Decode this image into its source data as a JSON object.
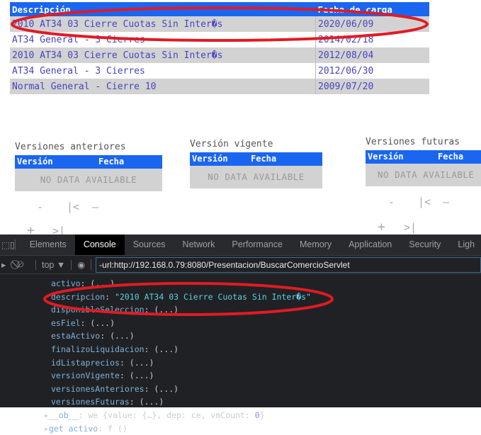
{
  "main_table": {
    "headers": [
      "Descripción",
      "Fecha de carga"
    ],
    "rows": [
      {
        "descripcion": "2010 AT34 03 Cierre Cuotas Sin Inter�s",
        "fecha": "2020/06/09"
      },
      {
        "descripcion": "AT34 General - 3 Cierres",
        "fecha": "2014/02/18"
      },
      {
        "descripcion": "2010 AT34 03 Cierre Cuotas Sin Inter�s",
        "fecha": "2012/08/04"
      },
      {
        "descripcion": "AT34 General - 3 Cierres",
        "fecha": "2012/06/30"
      },
      {
        "descripcion": "Normal General - Cierre 10",
        "fecha": "2009/07/20"
      }
    ]
  },
  "versions": {
    "anteriores": {
      "title": "Versiones anteriores",
      "col1": "Versión",
      "col2": "Fecha",
      "empty": "NO DATA AVAILABLE"
    },
    "vigente": {
      "title": "Versión vigente",
      "col1": "Versión",
      "col2": "Fecha",
      "empty": "NO DATA AVAILABLE"
    },
    "futuras": {
      "title": "Versiones futuras",
      "col1": "Versión",
      "col2": "Fecha",
      "empty": "NO DATA AVAILABLE"
    },
    "pager": {
      "minus": "-",
      "first": "|<",
      "dash": "—",
      "plus": "+",
      "last": ">|"
    }
  },
  "devtools": {
    "tabs": [
      "Elements",
      "Console",
      "Sources",
      "Network",
      "Performance",
      "Memory",
      "Application",
      "Security",
      "Ligh"
    ],
    "active_tab": "Console",
    "context": "top ▼",
    "filter": "-url:http://192.168.0.79:8080/Presentacion/BuscarComercioServlet",
    "lines": [
      {
        "key": "activo",
        "val": "(...)"
      },
      {
        "key": "descripcion",
        "val": "\"2010 AT34 03 Cierre Cuotas Sin Inter�s\"",
        "str": true
      },
      {
        "key": "disponibleSeleccion",
        "val": "(...)"
      },
      {
        "key": "esFiel",
        "val": "(...)"
      },
      {
        "key": "estaActivo",
        "val": "(...)"
      },
      {
        "key": "finalizoLiquidacion",
        "val": "(...)"
      },
      {
        "key": "idListaprecios",
        "val": "(...)"
      },
      {
        "key": "versionVigente",
        "val": "(...)"
      },
      {
        "key": "versionesAnteriores",
        "val": "(...)"
      },
      {
        "key": "versionesFuturas",
        "val": "(...)"
      }
    ],
    "ob_line": {
      "key": "__ob__",
      "val": "we {value: {…}, dep: ce, vmCount: ",
      "num": "0",
      "end": "}"
    },
    "get_line": {
      "key": "get activo",
      "val": "f ()"
    }
  },
  "colors": {
    "header": "#1a66f0",
    "annotation": "#e01b24"
  }
}
